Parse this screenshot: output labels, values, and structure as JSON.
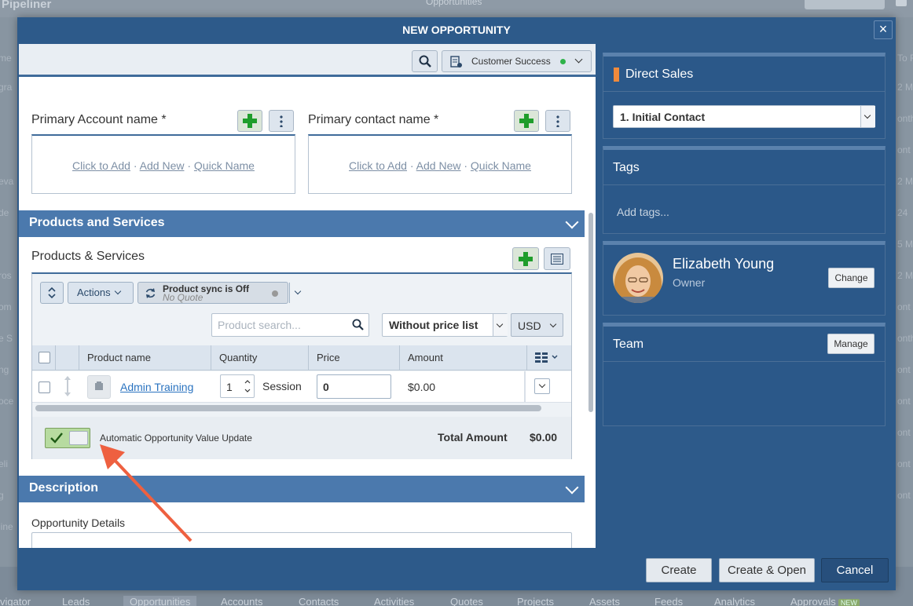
{
  "background": {
    "app_name": "Pipeliner",
    "center_title": "Opportunities",
    "side_fragments": [
      "me",
      "gra",
      "eva",
      "de",
      "ros",
      "om",
      "e S",
      "ng",
      "oce",
      "eli",
      "g",
      "line"
    ],
    "right_fragments": [
      "To F",
      "2 M",
      "onth",
      "ont",
      "2 M",
      "24",
      "5 M",
      "2 M",
      "ont",
      "onth",
      "ont",
      "ont",
      "ont",
      "ont",
      "ont"
    ],
    "bottom_tabs": [
      "vigator",
      "Leads",
      "Opportunities",
      "Accounts",
      "Contacts",
      "Activities",
      "Quotes",
      "Projects",
      "Assets",
      "Feeds",
      "Analytics",
      "Approvals"
    ],
    "new_badge": "NEW"
  },
  "modal": {
    "title": "NEW OPPORTUNITY",
    "close": "×"
  },
  "toolbar": {
    "template_label": "Customer Success",
    "status_color": "#2fb34a"
  },
  "primary_account": {
    "label": "Primary Account name *",
    "click_to_add": "Click to Add",
    "add_new": "Add New",
    "quick_name": "Quick Name",
    "sep": "·"
  },
  "primary_contact": {
    "label": "Primary contact name *",
    "click_to_add": "Click to Add",
    "add_new": "Add New",
    "quick_name": "Quick Name",
    "sep": "·"
  },
  "products_section": {
    "header": "Products and Services",
    "subheader": "Products & Services",
    "actions": "Actions",
    "sync_title": "Product sync is Off",
    "sync_sub": "No Quote",
    "search_placeholder": "Product search...",
    "price_list": "Without price list",
    "currency": "USD",
    "columns": [
      "Product name",
      "Quantity",
      "Price",
      "Amount"
    ],
    "rows": [
      {
        "name": "Admin Training",
        "quantity": "1",
        "unit": "Session",
        "price": "0",
        "amount": "$0.00"
      }
    ],
    "auto_update": "Automatic Opportunity Value Update",
    "total_label": "Total Amount",
    "total_value": "$0.00"
  },
  "description_section": {
    "header": "Description",
    "details_label": "Opportunity Details"
  },
  "right_panel": {
    "pipeline": "Direct Sales",
    "pipeline_color": "#f08a3c",
    "step": "1. Initial Contact",
    "tags_title": "Tags",
    "tags_placeholder": "Add tags...",
    "owner_name": "Elizabeth Young",
    "owner_role": "Owner",
    "change": "Change",
    "team_title": "Team",
    "manage": "Manage"
  },
  "footer": {
    "create": "Create",
    "create_open": "Create & Open",
    "cancel": "Cancel"
  }
}
